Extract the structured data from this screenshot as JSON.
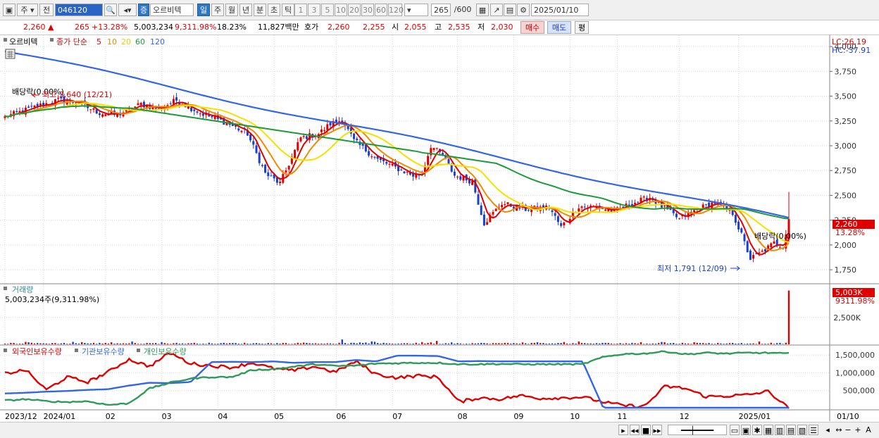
{
  "toolbar": {
    "market": "주",
    "prev": "전",
    "code": "046120",
    "stock_badge": "증",
    "stock_name": "오르비텍",
    "periods": [
      "일",
      "주",
      "월",
      "년",
      "분",
      "초",
      "틱"
    ],
    "intervals": [
      "1",
      "3",
      "5",
      "10",
      "20",
      "30",
      "60",
      "120"
    ],
    "count": "265",
    "count_max": "/600",
    "date": "2025/01/10"
  },
  "info": {
    "price": "2,260",
    "arrow": "▲",
    "change": "265",
    "change_pct": "+13.28%",
    "volume": "5,003,234",
    "volume_pct": "9,311.98%",
    "turnover": "18.23%",
    "amount": "11,827백만",
    "quote_label": "호가",
    "ask": "2,260",
    "bid": "2,255",
    "open_label": "시",
    "open": "2,055",
    "high_label": "고",
    "high": "2,535",
    "low_label": "저",
    "low": "2,030",
    "buy": "매수",
    "sell": "매도",
    "avg": "평"
  },
  "colors": {
    "up": "#e00000",
    "down": "#1a3fd0",
    "ma5": "#e00000",
    "ma10": "#f08a00",
    "ma20": "#f5e000",
    "ma60": "#1b9a3a",
    "ma120": "#3366e6",
    "foreign": "#e00000",
    "institution": "#3366e6",
    "individual": "#2f9a5a"
  },
  "chart_data": [
    {
      "type": "candlestick",
      "title": "오르비텍",
      "legend_prefix": "종가 단순",
      "ma_periods": [
        "5",
        "10",
        "20",
        "60",
        "120"
      ],
      "y_ticks": [
        "4,000",
        "3,750",
        "3,500",
        "3,250",
        "3,000",
        "2,750",
        "2,500",
        "2,250",
        "2,000",
        "1,750"
      ],
      "ylim": [
        1630,
        4100
      ],
      "y_tick_values": [
        4000,
        3750,
        3500,
        3250,
        3000,
        2750,
        2500,
        2250,
        2000,
        1750
      ],
      "top_right": [
        "LC:26.19",
        "HC:-37.91"
      ],
      "last_price_label": "2,260",
      "last_change_label": "13.28%",
      "annotations": [
        {
          "text": "배당락(0.00%)"
        },
        {
          "text": "최고 3,640 (12/21)"
        },
        {
          "text": "배당락(0.00%)"
        },
        {
          "text": "최저 1,791 (12/09)"
        }
      ],
      "price_keypoints": [
        [
          0,
          3290
        ],
        [
          10,
          3390
        ],
        [
          18,
          3460
        ],
        [
          24,
          3440
        ],
        [
          32,
          3330
        ],
        [
          38,
          3310
        ],
        [
          46,
          3420
        ],
        [
          52,
          3370
        ],
        [
          58,
          3460
        ],
        [
          66,
          3330
        ],
        [
          75,
          3230
        ],
        [
          82,
          3120
        ],
        [
          88,
          2720
        ],
        [
          93,
          2620
        ],
        [
          100,
          3080
        ],
        [
          106,
          3120
        ],
        [
          110,
          3220
        ],
        [
          114,
          3260
        ],
        [
          118,
          3050
        ],
        [
          126,
          2860
        ],
        [
          132,
          2780
        ],
        [
          138,
          2700
        ],
        [
          141,
          2720
        ],
        [
          144,
          3000
        ],
        [
          148,
          2900
        ],
        [
          152,
          2700
        ],
        [
          158,
          2640
        ],
        [
          162,
          2220
        ],
        [
          168,
          2420
        ],
        [
          176,
          2360
        ],
        [
          184,
          2380
        ],
        [
          188,
          2180
        ],
        [
          194,
          2390
        ],
        [
          200,
          2380
        ],
        [
          206,
          2340
        ],
        [
          212,
          2420
        ],
        [
          218,
          2480
        ],
        [
          222,
          2390
        ],
        [
          228,
          2260
        ],
        [
          234,
          2360
        ],
        [
          240,
          2430
        ],
        [
          246,
          2320
        ],
        [
          249,
          2100
        ],
        [
          252,
          1860
        ],
        [
          256,
          1930
        ],
        [
          260,
          2020
        ],
        [
          263,
          1985
        ],
        [
          265,
          2260
        ]
      ]
    },
    {
      "type": "bar",
      "title": "거래량",
      "label": "5,003,234주(9,311.98%)",
      "y_ticks": [
        "2,500K"
      ],
      "y_tick_values": [
        2500
      ],
      "last_label": "5,003K",
      "last_pct_label": "9311.98%",
      "ylim": [
        0,
        5300
      ],
      "last_value": 5003
    },
    {
      "type": "line",
      "series": [
        {
          "name": "외국인보유수량",
          "values": [
            980000,
            1080000,
            520000,
            880000,
            740000,
            1020000,
            1380000,
            1180000,
            1560000,
            1260000,
            1200000,
            1150000,
            1280000,
            1120000,
            1060000,
            1180000,
            1020000,
            1320000,
            960000,
            860000,
            920000,
            880000,
            180000,
            300000,
            260000,
            360000,
            280000,
            300000,
            320000,
            180000,
            80000,
            60000,
            620000,
            560000,
            330000,
            350000,
            380000,
            480000,
            0
          ]
        },
        {
          "name": "기관보유수량",
          "values": [
            420000,
            440000,
            470000,
            490000,
            520000,
            540000,
            640000,
            720000,
            710000,
            740000,
            1300000,
            1310000,
            1300000,
            1320000,
            1280000,
            1300000,
            1300000,
            1360000,
            1320000,
            1480000,
            1480000,
            1470000,
            1320000,
            1330000,
            1320000,
            1320000,
            1320000,
            1320000,
            1320000,
            20000,
            20000,
            20000,
            20000,
            20000,
            20000,
            20000,
            20000,
            20000,
            20000
          ]
        },
        {
          "name": "개인보유수량",
          "values": [
            220000,
            260000,
            200000,
            180000,
            200000,
            100000,
            140000,
            560000,
            720000,
            840000,
            880000,
            880000,
            1080000,
            1100000,
            1170000,
            1240000,
            1190000,
            1200000,
            1260000,
            1270000,
            1280000,
            1280000,
            1240000,
            1240000,
            1250000,
            1240000,
            1240000,
            1240000,
            1240000,
            1440000,
            1530000,
            1540000,
            1600000,
            1520000,
            1560000,
            1540000,
            1560000,
            1560000,
            1540000
          ]
        }
      ],
      "y_ticks": [
        "1,500,000",
        "1,000,000",
        "500,000"
      ],
      "y_tick_values": [
        1500000,
        1000000,
        500000
      ],
      "ylim": [
        0,
        1700000
      ]
    }
  ],
  "x_axis": {
    "labels": [
      {
        "text": "2023/12",
        "i": 0
      },
      {
        "text": "2024/01",
        "i": 13
      },
      {
        "text": "02",
        "i": 34
      },
      {
        "text": "03",
        "i": 53
      },
      {
        "text": "04",
        "i": 72
      },
      {
        "text": "05",
        "i": 91
      },
      {
        "text": "06",
        "i": 112
      },
      {
        "text": "07",
        "i": 131
      },
      {
        "text": "08",
        "i": 153
      },
      {
        "text": "09",
        "i": 172
      },
      {
        "text": "10",
        "i": 191
      },
      {
        "text": "11",
        "i": 207
      },
      {
        "text": "12",
        "i": 228
      },
      {
        "text": "2025/01",
        "i": 248
      }
    ],
    "right_label": "01/10"
  }
}
